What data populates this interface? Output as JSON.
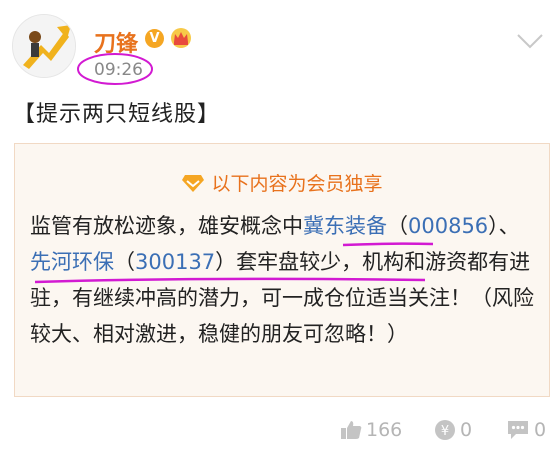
{
  "post": {
    "username": "刀锋",
    "vip_badge_glyph": "V",
    "time": "09:26",
    "title": "【提示两只短线股】"
  },
  "vip": {
    "header": "以下内容为会员独享"
  },
  "content": {
    "p1": "监管有放松迹象，雄安概念中",
    "link1": "冀东装备",
    "p2": "（",
    "link2": "000856",
    "p3": "）、",
    "link3": "先河环保",
    "p4": "（",
    "link4": "300137",
    "p5": "）套牢盘较少，机构和游资都有进驻，有继续冲高的潜力，可一成仓位适当关注！（风险较大、相对激进，稳健的朋友可忽略！）"
  },
  "actions": {
    "likes": "166",
    "coins": "0",
    "comments": "0"
  },
  "colors": {
    "accent_orange": "#e8721d",
    "link_blue": "#3b6fb5",
    "annotation_magenta": "#d21ad2",
    "vip_bg": "#fcf7f1"
  }
}
